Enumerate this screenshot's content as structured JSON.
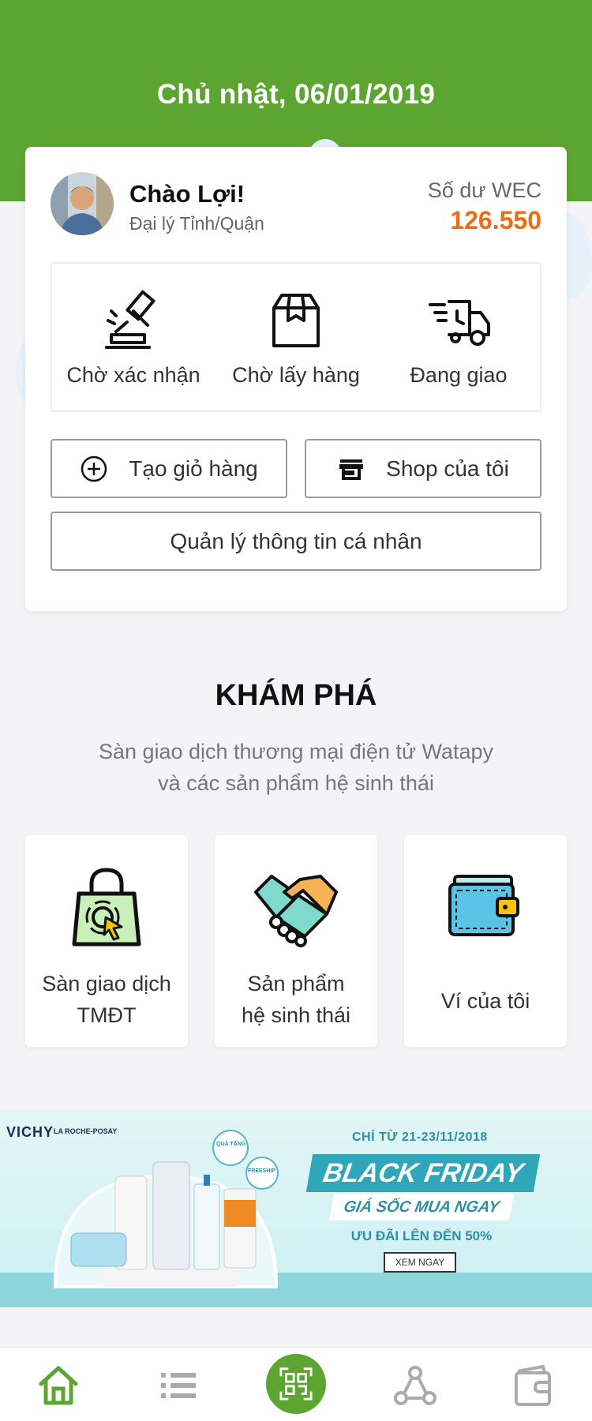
{
  "header": {
    "date": "Chủ nhật, 06/01/2019"
  },
  "profile": {
    "greeting": "Chào Lợi!",
    "role": "Đại lý Tỉnh/Quận",
    "balance_label": "Số dư WEC",
    "balance_value": "126.550"
  },
  "order_status": [
    {
      "label": "Chờ xác nhận",
      "icon": "gavel-icon"
    },
    {
      "label": "Chờ lấy hàng",
      "icon": "box-icon"
    },
    {
      "label": "Đang giao",
      "icon": "delivery-truck-icon"
    }
  ],
  "actions": {
    "create_cart": "Tạo giỏ hàng",
    "my_shop": "Shop của tôi",
    "manage_profile": "Quản lý thông tin cá nhân"
  },
  "explore": {
    "title": "KHÁM PHÁ",
    "subtitle_line1": "Sàn giao dịch thương mại điện tử Watapy",
    "subtitle_line2": "và các sản phẩm hệ sinh thái",
    "items": [
      {
        "line1": "Sàn giao dịch",
        "line2": "TMĐT",
        "icon": "shopping-bag-icon"
      },
      {
        "line1": "Sản phẩm",
        "line2": "hệ sinh thái",
        "icon": "handshake-icon"
      },
      {
        "line1": "Ví của tôi",
        "line2": "",
        "icon": "wallet-icon"
      }
    ]
  },
  "banner": {
    "brand1": "VICHY",
    "brand2": "LA ROCHE-POSAY",
    "dates": "CHỈ TỪ 21-23/11/2018",
    "title": "BLACK FRIDAY",
    "subtitle": "GIÁ SỐC MUA NGAY",
    "offer": "ƯU ĐÃI LÊN ĐẾN 50%",
    "cta": "XEM NGAY",
    "badge1": "QUÀ TẶNG",
    "badge2": "FREESHIP"
  },
  "tabbar": [
    {
      "name": "home",
      "icon": "home-icon",
      "active": true
    },
    {
      "name": "list",
      "icon": "list-icon",
      "active": false
    },
    {
      "name": "scan",
      "icon": "qr-scan-icon",
      "active": false
    },
    {
      "name": "network",
      "icon": "network-icon",
      "active": false
    },
    {
      "name": "wallet",
      "icon": "wallet-icon",
      "active": false
    }
  ],
  "colors": {
    "brand_green": "#5ca531",
    "balance_orange": "#ef6c15",
    "banner_teal": "#2fa7b8"
  }
}
